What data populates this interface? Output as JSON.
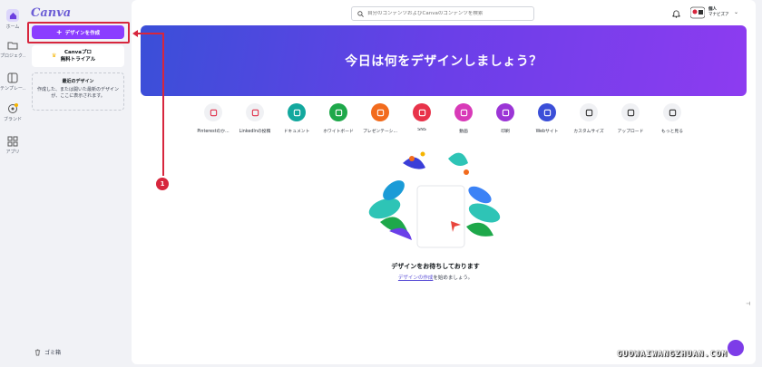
{
  "rail": {
    "items": [
      {
        "label": "ホーム",
        "icon": "home-icon"
      },
      {
        "label": "プロジェク...",
        "icon": "folder-icon"
      },
      {
        "label": "テンプレー...",
        "icon": "template-icon"
      },
      {
        "label": "ブランド",
        "icon": "brand-icon"
      },
      {
        "label": "アプリ",
        "icon": "apps-icon"
      }
    ]
  },
  "sidebar": {
    "logo": "Canva",
    "create_button": "デザインを作成",
    "pro_line1": "Canvaプロ",
    "pro_line2": "無料トライアル",
    "recent_title": "最近のデザイン",
    "recent_line1": "作成した、または開いた最新のデザイン",
    "recent_line2": "が、ここに表示されます。",
    "trash_label": "ゴミ箱"
  },
  "header": {
    "search_placeholder": "自分のコンテンツおよびCanvaのコンテンツを検索",
    "account_line1": "個人",
    "account_line2": "マナビズア"
  },
  "banner": {
    "title": "今日は何をデザインしましょう？"
  },
  "design_types": [
    {
      "label": "Pinterestのか...",
      "color": "#f0f1f4",
      "fg": "#e0314b"
    },
    {
      "label": "LinkedInの投稿",
      "color": "#f0f1f4",
      "fg": "#e0314b"
    },
    {
      "label": "ドキュメント",
      "color": "#13a89e",
      "fg": "#ffffff"
    },
    {
      "label": "ホワイトボード",
      "color": "#1ea84a",
      "fg": "#ffffff"
    },
    {
      "label": "プレゼンテーシ...",
      "color": "#f26b1d",
      "fg": "#ffffff"
    },
    {
      "label": "SNS",
      "color": "#e8334a",
      "fg": "#ffffff"
    },
    {
      "label": "動画",
      "color": "#d83ab8",
      "fg": "#ffffff"
    },
    {
      "label": "印刷",
      "color": "#9b35d6",
      "fg": "#ffffff"
    },
    {
      "label": "Webサイト",
      "color": "#3b4fd8",
      "fg": "#ffffff"
    },
    {
      "label": "カスタムサイズ",
      "color": "#f0f1f4",
      "fg": "#333333"
    },
    {
      "label": "アップロード",
      "color": "#f0f1f4",
      "fg": "#333333"
    },
    {
      "label": "もっと見る",
      "color": "#f0f1f4",
      "fg": "#333333"
    }
  ],
  "empty": {
    "title": "デザインをお待ちしております",
    "link": "デザインの作成",
    "rest": "を始めましょう。"
  },
  "annotation": {
    "badge": "1"
  },
  "watermark": "GUOWAIWANGZHUAN.COM"
}
